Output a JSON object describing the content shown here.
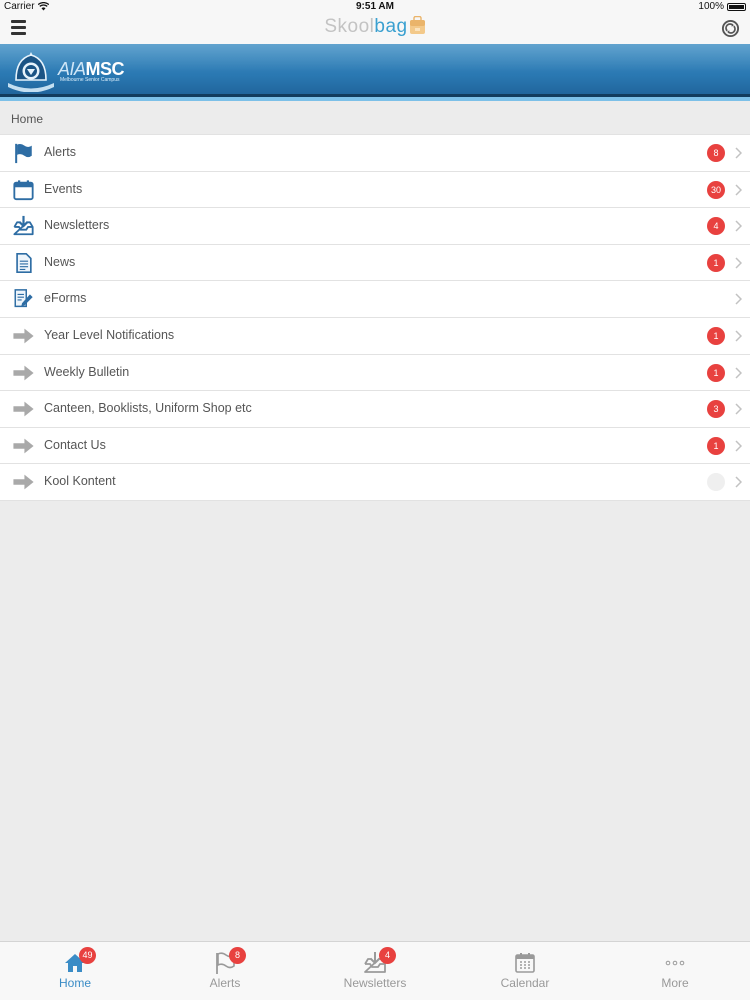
{
  "status_bar": {
    "carrier": "Carrier",
    "time": "9:51 AM",
    "battery": "100%"
  },
  "nav": {
    "title_part1": "Skool",
    "title_part2": "bag"
  },
  "banner": {
    "school_name_a": "AIA",
    "school_name_b": "MSC",
    "school_subtitle": "Melbourne Senior Campus"
  },
  "breadcrumb": "Home",
  "menu_items": [
    {
      "label": "Alerts",
      "icon": "flag-icon",
      "badge": "8"
    },
    {
      "label": "Events",
      "icon": "calendar-icon",
      "badge": "30"
    },
    {
      "label": "Newsletters",
      "icon": "inbox-download-icon",
      "badge": "4"
    },
    {
      "label": "News",
      "icon": "document-icon",
      "badge": "1"
    },
    {
      "label": "eForms",
      "icon": "form-edit-icon",
      "badge": ""
    },
    {
      "label": "Year Level Notifications",
      "icon": "arrow-right-icon",
      "badge": "1"
    },
    {
      "label": "Weekly Bulletin",
      "icon": "arrow-right-icon",
      "badge": "1"
    },
    {
      "label": "Canteen, Booklists, Uniform Shop etc",
      "icon": "arrow-right-icon",
      "badge": "3"
    },
    {
      "label": "Contact Us",
      "icon": "arrow-right-icon",
      "badge": "1"
    },
    {
      "label": "Kool Kontent",
      "icon": "arrow-right-icon",
      "badge": ""
    }
  ],
  "tabs": [
    {
      "label": "Home",
      "icon": "home-icon",
      "badge": "49",
      "active": true
    },
    {
      "label": "Alerts",
      "icon": "flag-icon",
      "badge": "8",
      "active": false
    },
    {
      "label": "Newsletters",
      "icon": "inbox-download-icon",
      "badge": "4",
      "active": false
    },
    {
      "label": "Calendar",
      "icon": "calendar-icon",
      "badge": "",
      "active": false
    },
    {
      "label": "More",
      "icon": "more-dots-icon",
      "badge": "",
      "active": false
    }
  ],
  "colors": {
    "accent": "#3a8cc6",
    "badge": "#e8413f",
    "banner": "#2a78b2",
    "icon_blue": "#2e6da4",
    "arrow_gray": "#a9a9a9"
  }
}
